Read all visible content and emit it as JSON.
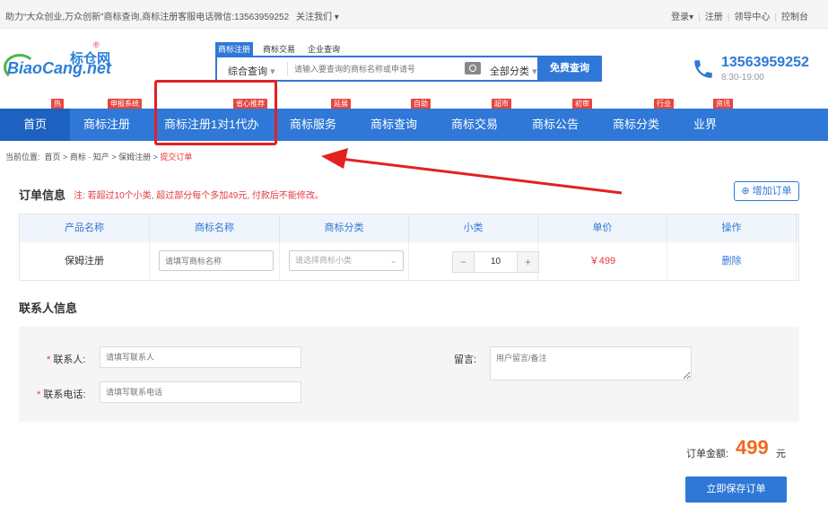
{
  "topbar": {
    "slogan": "助力“大众创业,万众创新”商标查询,商标注册客服电话微信:13563959252",
    "follow": "关注我们",
    "login": "登录",
    "register": "注册",
    "lead": "领导中心",
    "console": "控制台"
  },
  "logo": {
    "cn": "标仓网",
    "en": "BiaoCang.net",
    "reg": "®"
  },
  "search": {
    "tabs": [
      "商标注册",
      "商标交易",
      "企业查询"
    ],
    "category": "综合查询",
    "placeholder": "请输入要查询的商标名称或申请号",
    "scope": "全部分类",
    "button": "免费查询"
  },
  "contact_phone": {
    "number": "13563959252",
    "hours": "8:30-19:00"
  },
  "nav": {
    "items": [
      {
        "label": "首页",
        "badge": "热"
      },
      {
        "label": "商标注册",
        "badge": "申报系统"
      },
      {
        "label": "商标注册1对1代办",
        "badge": "省心推荐"
      },
      {
        "label": "商标服务",
        "badge": "延展"
      },
      {
        "label": "商标查询",
        "badge": "自助"
      },
      {
        "label": "商标交易",
        "badge": "超市"
      },
      {
        "label": "商标公告",
        "badge": "初审"
      },
      {
        "label": "商标分类",
        "badge": "行业"
      },
      {
        "label": "业界",
        "badge": "资讯"
      }
    ]
  },
  "breadcrumb": {
    "prefix": "当前位置:",
    "items": [
      "首页",
      "商标 · 知产",
      "保姆注册"
    ],
    "current": "提交订单"
  },
  "order": {
    "title": "订单信息",
    "note": "注: 若超过10个小类, 超过部分每个多加49元, 付款后不能修改。",
    "add_button": "增加订单",
    "columns": [
      "产品名称",
      "商标名称",
      "商标分类",
      "小类",
      "单价",
      "操作"
    ],
    "row": {
      "product": "保姆注册",
      "name_placeholder": "请填写商标名称",
      "class_placeholder": "请选择商标小类",
      "quantity": "10",
      "price": "￥499",
      "action": "删除"
    }
  },
  "contact": {
    "title": "联系人信息",
    "name_label": "联系人:",
    "name_placeholder": "请填写联系人",
    "phone_label": "联系电话:",
    "phone_placeholder": "请填写联系电话",
    "remark_label": "留言:",
    "remark_placeholder": "用户留言/备注"
  },
  "total": {
    "label": "订单金额:",
    "amount": "499",
    "unit": "元"
  },
  "submit_label": "立即保存订单",
  "colors": {
    "primary": "#2f78d7",
    "badge": "#e8453c",
    "price": "#f06a1e",
    "annotation": "#e32020"
  }
}
